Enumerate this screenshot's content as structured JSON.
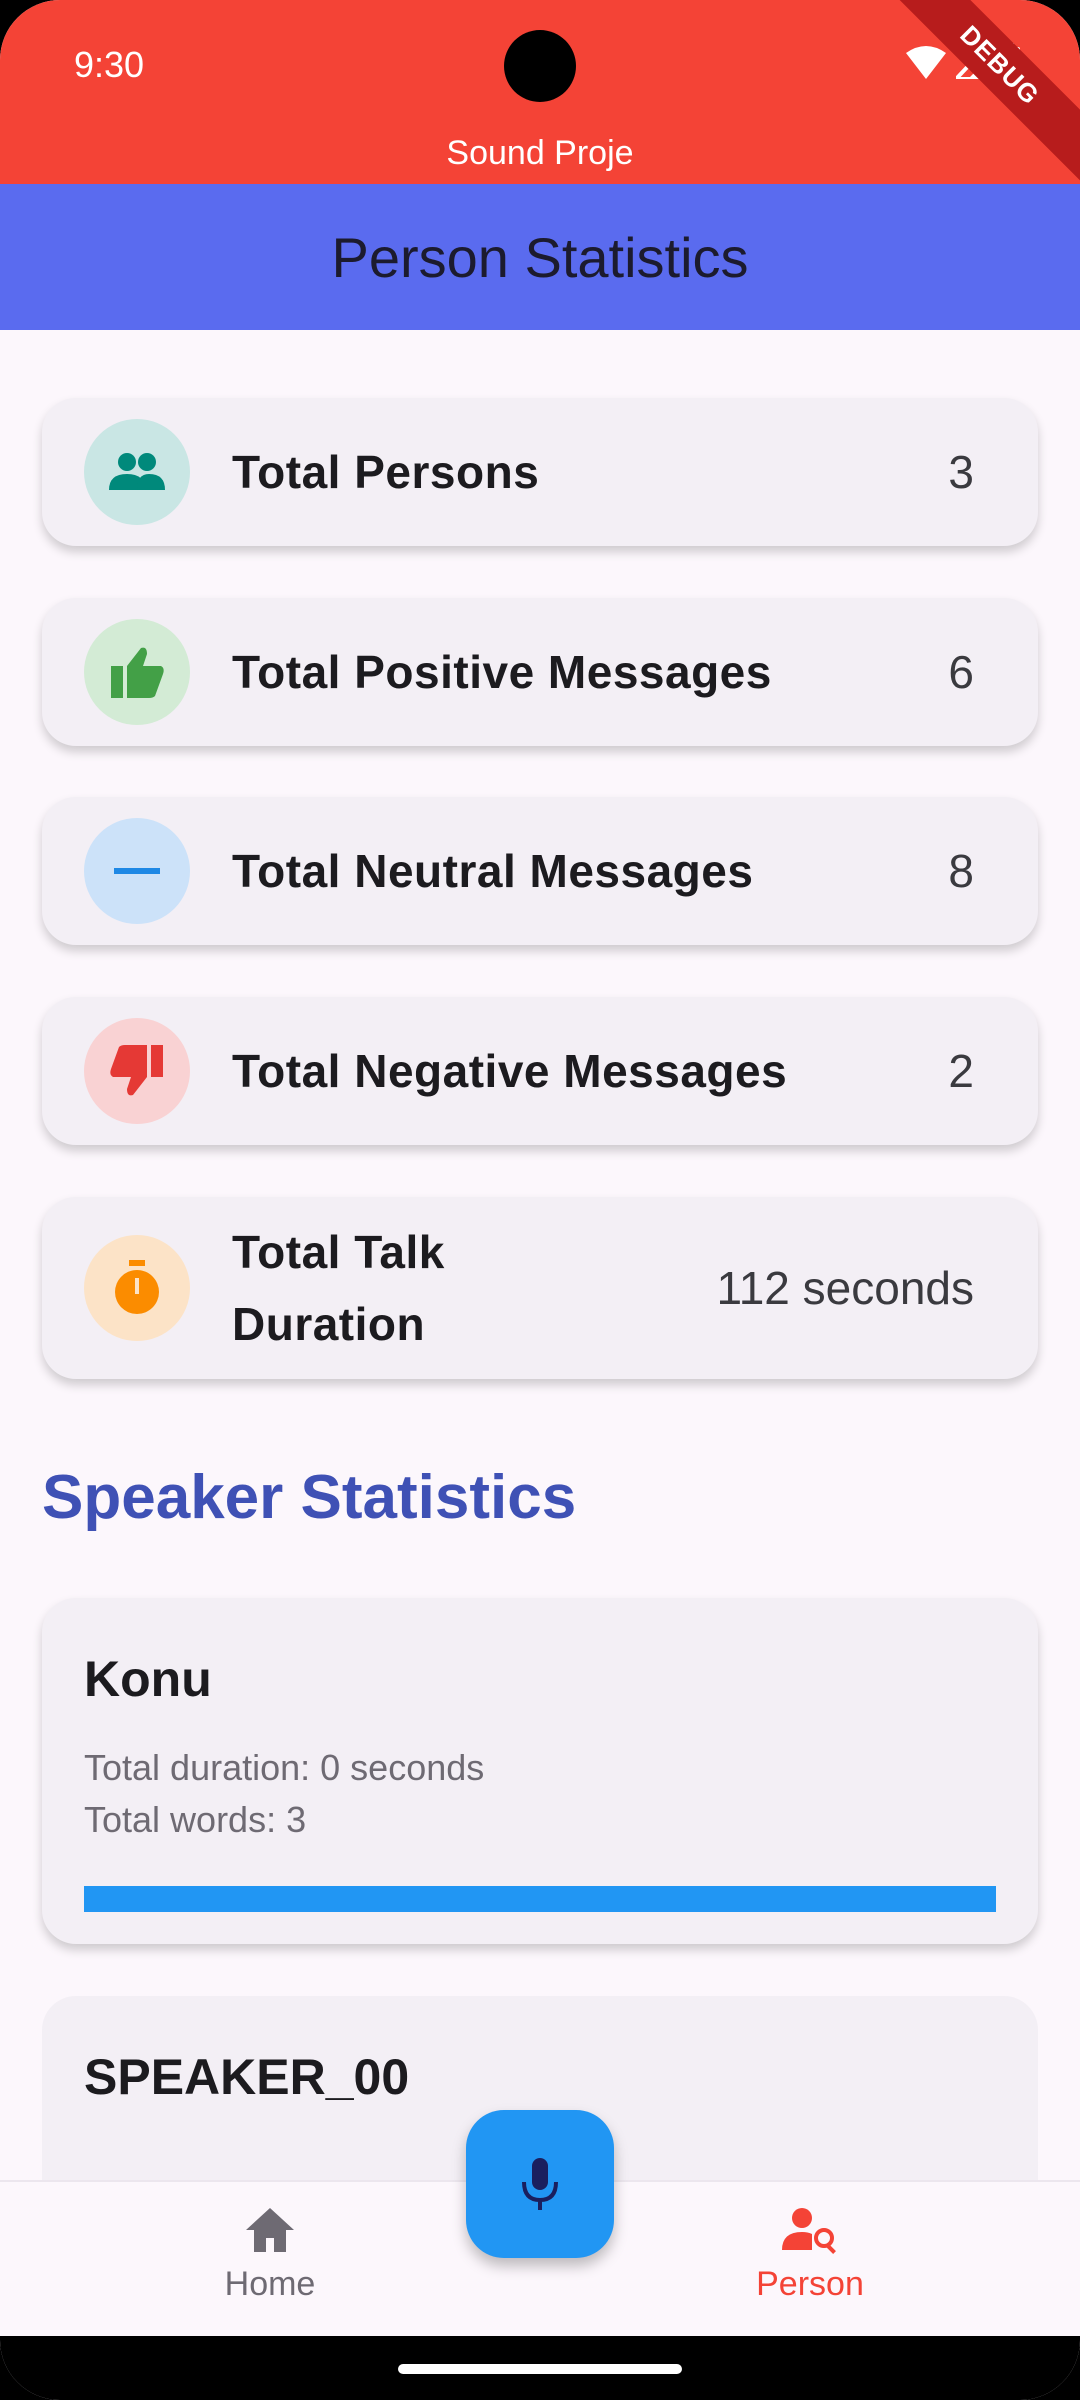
{
  "status_bar": {
    "time": "9:30",
    "app_name": "Sound Proje",
    "debug_label": "DEBUG"
  },
  "app_bar": {
    "title": "Person Statistics"
  },
  "stats": [
    {
      "label": "Total Persons",
      "value": "3",
      "icon": "people-icon",
      "icon_color": "#00897B",
      "icon_bg": "#C9E6E4"
    },
    {
      "label": "Total Positive Messages",
      "value": "6",
      "icon": "thumbs-up-icon",
      "icon_color": "#43A047",
      "icon_bg": "#D3EBD5"
    },
    {
      "label": "Total Neutral Messages",
      "value": "8",
      "icon": "minus-icon",
      "icon_color": "#1E88E5",
      "icon_bg": "#CCE2F9"
    },
    {
      "label": "Total Negative Messages",
      "value": "2",
      "icon": "thumbs-down-icon",
      "icon_color": "#E53935",
      "icon_bg": "#F9D2D3"
    },
    {
      "label": "Total Talk Duration",
      "value": "112 seconds",
      "icon": "timer-icon",
      "icon_color": "#FB8C00",
      "icon_bg": "#FCE3C7"
    }
  ],
  "section": {
    "title": "Speaker Statistics"
  },
  "speakers": [
    {
      "name": "Konu",
      "duration_text": "Total duration: 0 seconds",
      "words_text": "Total words: 3",
      "progress": 1.0
    },
    {
      "name": "SPEAKER_00"
    }
  ],
  "bottom_nav": {
    "items": [
      {
        "label": "Home",
        "icon": "home-icon",
        "color": "#6E6A73",
        "active": false
      },
      {
        "label": "Person",
        "icon": "person-search-icon",
        "color": "#F44336",
        "active": true
      }
    ],
    "fab_icon": "microphone-icon"
  },
  "colors": {
    "accent": "#2196F3",
    "status_bar": "#F44336",
    "app_bar": "#5A6BEF",
    "section_title": "#3F51B5"
  }
}
